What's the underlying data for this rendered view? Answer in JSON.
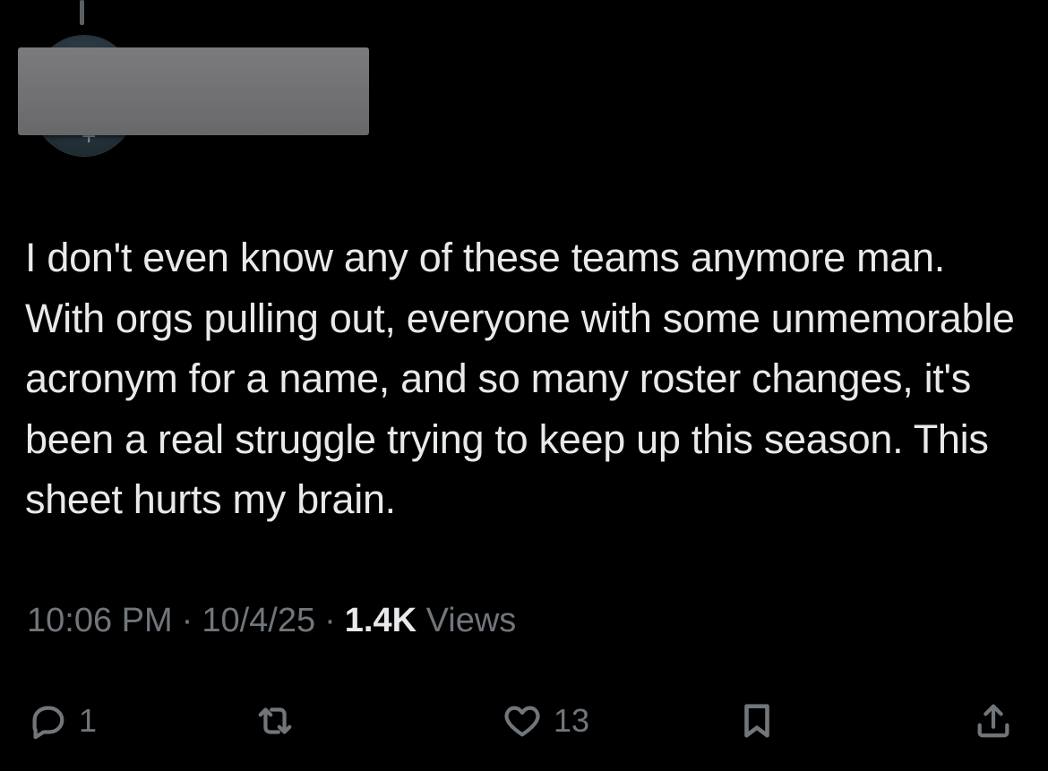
{
  "tweet": {
    "text": "I don't even know any of these teams anymore man. With orgs pulling out, everyone with some unmemorable acronym for a name, and so many roster changes, it's been a real struggle trying to keep up this season. This sheet hurts my brain.",
    "time": "10:06 PM",
    "separator": "·",
    "date": "10/4/25",
    "views_count": "1.4K",
    "views_label": "Views"
  },
  "actions": {
    "reply": {
      "icon": "reply-icon",
      "count": "1"
    },
    "retweet": {
      "icon": "retweet-icon"
    },
    "like": {
      "icon": "heart-icon",
      "count": "13"
    },
    "bookmark": {
      "icon": "bookmark-icon"
    },
    "share": {
      "icon": "share-icon"
    }
  },
  "colors": {
    "background": "#000000",
    "text": "#e7e9ea",
    "muted": "#71767b",
    "redaction": "#757577"
  }
}
